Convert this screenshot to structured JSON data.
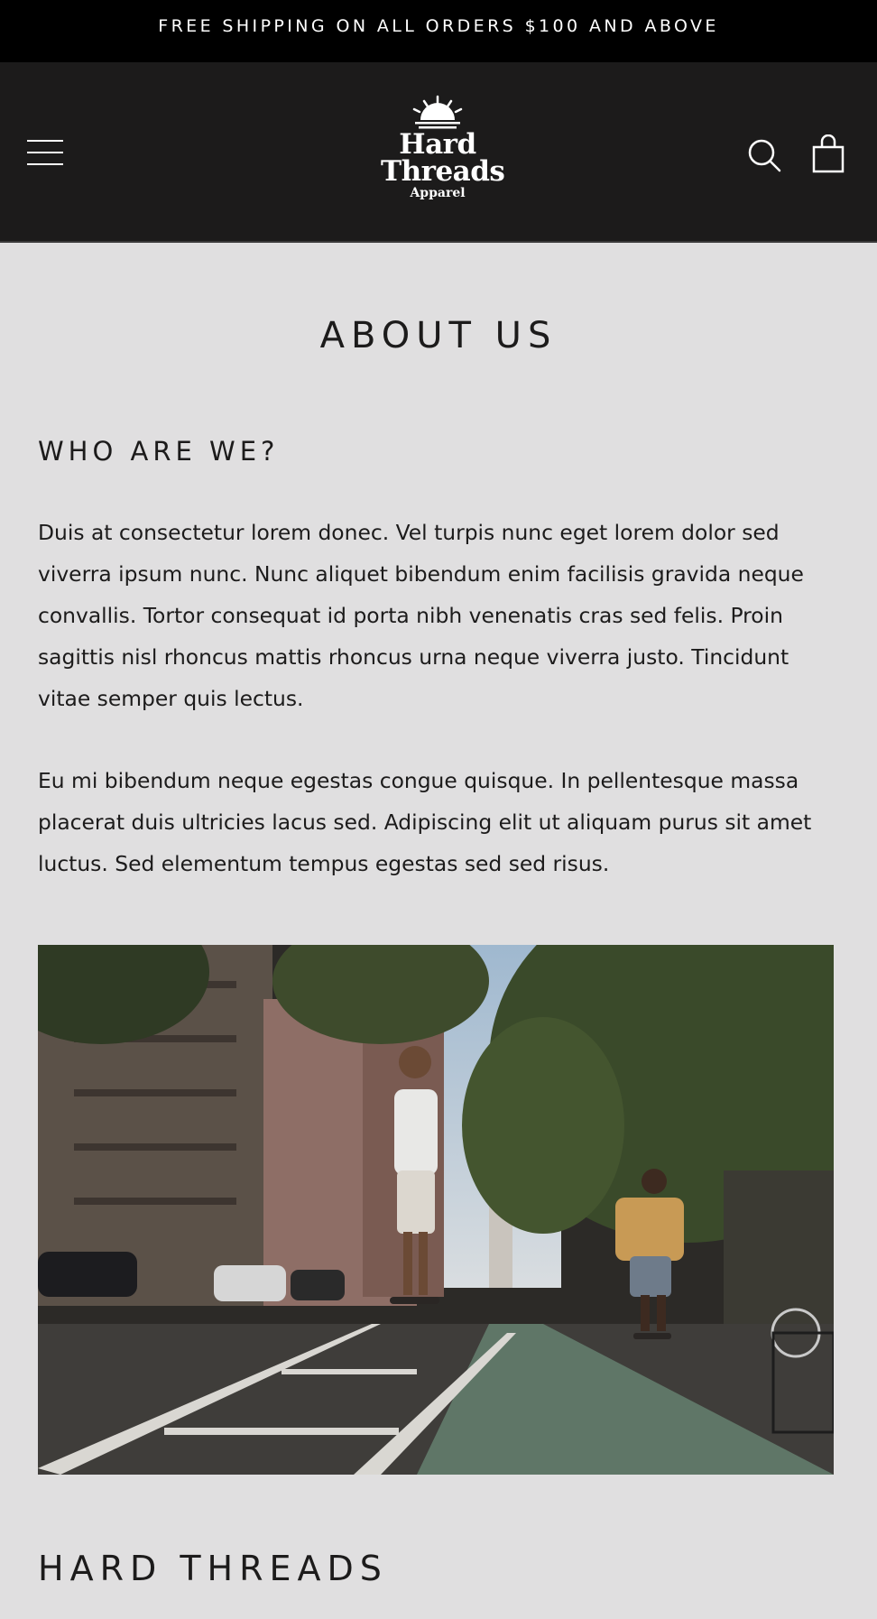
{
  "announcement": {
    "text": "FREE SHIPPING ON ALL ORDERS $100 AND ABOVE"
  },
  "header": {
    "logo": {
      "line1": "Hard",
      "line2": "Threads",
      "line3": "Apparel"
    },
    "icons": {
      "menu": "hamburger-menu-icon",
      "search": "search-icon",
      "cart": "shopping-bag-icon"
    }
  },
  "page": {
    "title": "ABOUT US",
    "section1": {
      "heading": "WHO ARE WE?",
      "paragraph1": "Duis at consectetur lorem donec. Vel turpis nunc eget lorem dolor sed viverra ipsum nunc. Nunc aliquet bibendum enim facilisis gravida neque convallis. Tortor consequat id porta nibh venenatis cras sed felis. Proin sagittis nisl rhoncus mattis rhoncus urna neque viverra justo. Tincidunt vitae semper quis lectus.",
      "paragraph2": "Eu mi bibendum neque egestas congue quisque. In pellentesque massa placerat duis ultricies lacus sed. Adipiscing elit ut aliquam purus sit amet luctus. Sed elementum tempus egestas sed sed risus."
    },
    "section2": {
      "heading": "HARD THREADS"
    }
  },
  "colors": {
    "announcement_bg": "#000000",
    "header_bg": "#1c1b1b",
    "page_bg": "#e0dfe0",
    "text": "#1c1b1b"
  }
}
